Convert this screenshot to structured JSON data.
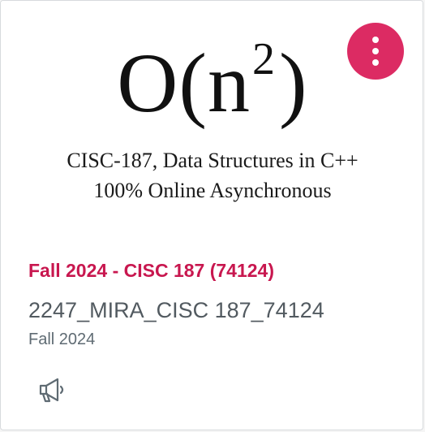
{
  "hero": {
    "formula_main": "O(n",
    "formula_sup": "2",
    "formula_close": ")",
    "line1": "CISC-187, Data Structures in C++",
    "line2": "100% Online Asynchronous"
  },
  "card": {
    "title": "Fall 2024 - CISC 187 (74124)",
    "code": "2247_MIRA_CISC 187_74124",
    "term": "Fall 2024",
    "accent_color": "#dc2b63",
    "title_color": "#c8174f"
  },
  "icons": {
    "menu": "more-options-vertical-icon",
    "announcements": "megaphone-icon"
  }
}
